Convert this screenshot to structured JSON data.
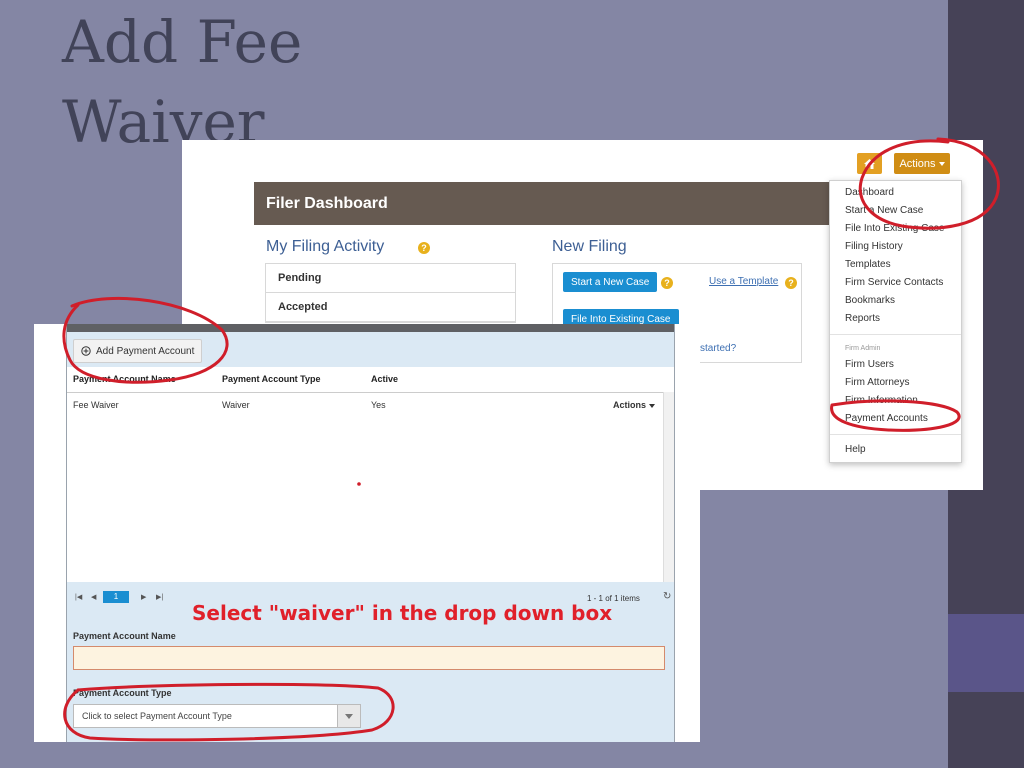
{
  "slide": {
    "title_line1": "Add Fee",
    "title_line2": "Waiver",
    "callout": "Select \"waiver\" in the drop down box"
  },
  "colors": {
    "background": "#8486a4",
    "side_strip": "#464257",
    "side_accent": "#5a5589",
    "dashboard_header": "#665a51",
    "button_blue": "#1a8ed1",
    "actions_orange": "#d08d14",
    "annotation_red": "#d01e2a"
  },
  "dashboard": {
    "header": "Filer Dashboard",
    "home_icon": "home-icon",
    "actions_label": "Actions",
    "my_filing_activity": {
      "title": "My Filing Activity",
      "items": [
        "Pending",
        "Accepted"
      ]
    },
    "new_filing": {
      "title": "New Filing",
      "start_new_case": "Start a New Case",
      "use_template": "Use a Template",
      "file_existing": "File Into Existing Case",
      "started_link": "started?"
    },
    "actions_menu": {
      "items": [
        "Dashboard",
        "Start a New Case",
        "File Into Existing Case",
        "Filing History",
        "Templates",
        "Firm Service Contacts",
        "Bookmarks",
        "Reports"
      ],
      "admin_header": "Firm Admin",
      "admin_items": [
        "Firm Users",
        "Firm Attorneys",
        "Firm Information",
        "Payment Accounts"
      ],
      "help": "Help"
    }
  },
  "payment_accounts": {
    "add_button": "Add Payment Account",
    "columns": [
      "Payment Account Name",
      "Payment Account Type",
      "Active"
    ],
    "rows": [
      {
        "name": "Fee Waiver",
        "type": "Waiver",
        "active": "Yes",
        "actions": "Actions"
      }
    ],
    "pager": {
      "page": "1",
      "info": "1 - 1 of 1 items"
    },
    "form": {
      "name_label": "Payment Account Name",
      "name_value": "",
      "type_label": "Payment Account Type",
      "type_placeholder": "Click to select Payment Account Type"
    }
  }
}
